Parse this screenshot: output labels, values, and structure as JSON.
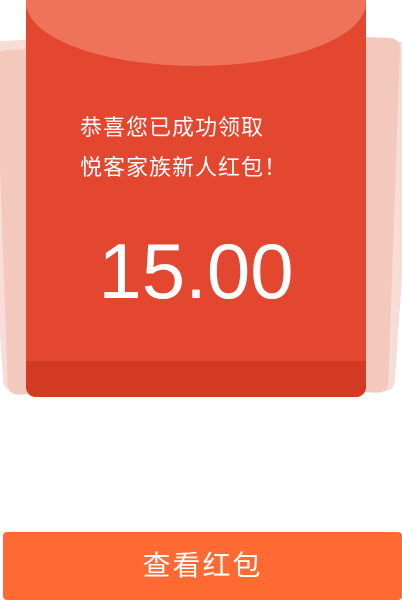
{
  "envelope": {
    "message_line1": "恭喜您已成功领取",
    "message_line2": "悦客家族新人红包！",
    "amount": "15.00",
    "colors": {
      "body": "#e4472f",
      "flap": "#ef735b",
      "bottom": "#d33a24",
      "fan_light": "#f7ddd6",
      "fan_mid": "#f4c9bd"
    }
  },
  "actions": {
    "view_label": "查看红包",
    "button_color": "#ff6a33"
  }
}
